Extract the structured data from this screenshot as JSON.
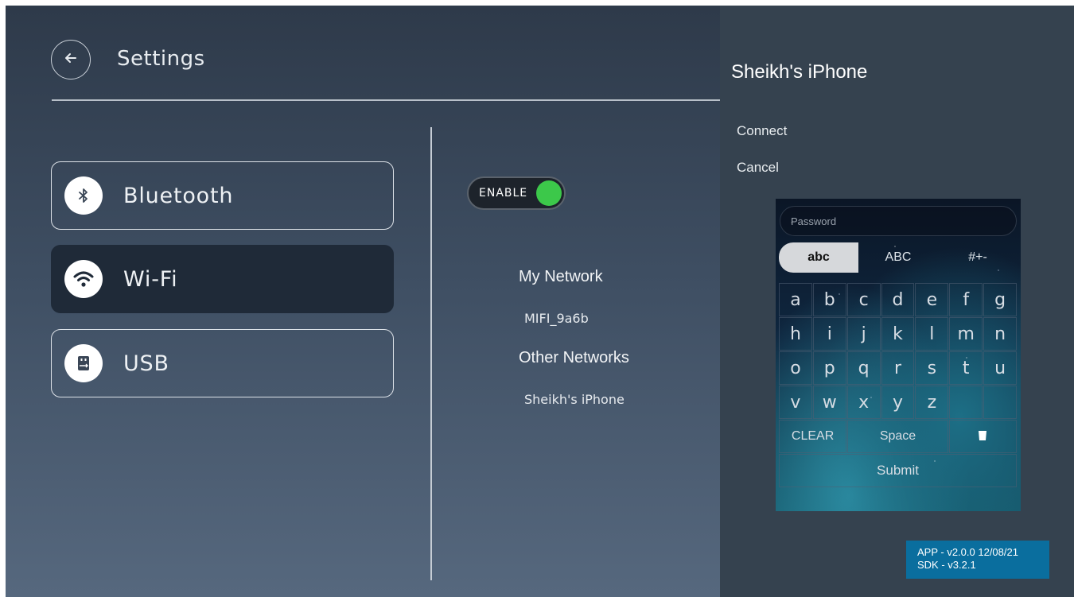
{
  "header": {
    "title": "Settings",
    "back_icon": "arrow-left-icon"
  },
  "menu": {
    "items": [
      {
        "label": "Bluetooth",
        "icon": "bluetooth-icon",
        "active": false
      },
      {
        "label": "Wi-Fi",
        "icon": "wifi-icon",
        "active": true
      },
      {
        "label": "USB",
        "icon": "usb-icon",
        "active": false
      }
    ]
  },
  "wifi": {
    "toggle_label": "ENABLE",
    "toggle_on_color": "#3cc84a",
    "my_network_heading": "My Network",
    "my_network": "MIFI_9a6b",
    "other_networks_heading": "Other Networks",
    "other_networks": [
      "Sheikh's iPhone"
    ]
  },
  "panel": {
    "title": "Sheikh's iPhone",
    "connect_label": "Connect",
    "cancel_label": "Cancel"
  },
  "keyboard": {
    "password_placeholder": "Password",
    "modes": [
      "abc",
      "ABC",
      "#+-"
    ],
    "active_mode": "abc",
    "rows": [
      [
        "a",
        "b",
        "c",
        "d",
        "e",
        "f",
        "g"
      ],
      [
        "h",
        "i",
        "j",
        "k",
        "l",
        "m",
        "n"
      ],
      [
        "o",
        "p",
        "q",
        "r",
        "s",
        "t",
        "u"
      ],
      [
        "v",
        "w",
        "x",
        "y",
        "z"
      ]
    ],
    "clear_label": "CLEAR",
    "space_label": "Space",
    "delete_icon": "trash-icon",
    "submit_label": "Submit"
  },
  "version": {
    "app": "APP - v2.0.0 12/08/21",
    "sdk": "SDK - v3.2.1",
    "background": "#0a6e9e"
  }
}
